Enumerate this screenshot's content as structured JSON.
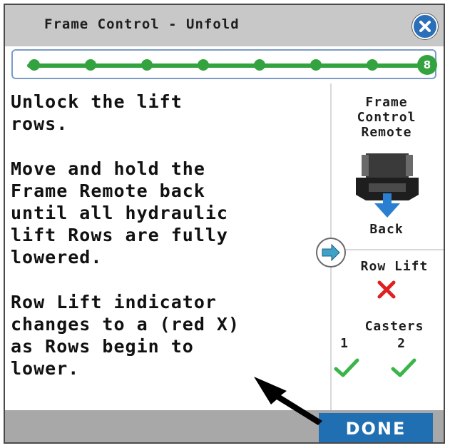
{
  "window": {
    "title": "Frame Control - Unfold"
  },
  "progress": {
    "current_step": "8",
    "total_steps": 8
  },
  "instructions": {
    "para1": "Unlock the lift\nrows.",
    "para2": "Move and hold the\nFrame Remote back\nuntil all hydraulic\nlift Rows are fully\nlowered.",
    "para3": "Row Lift indicator\nchanges to a (red X)\nas Rows begin to\nlower."
  },
  "remote": {
    "label": "Frame\nControl\nRemote",
    "direction_label": "Back"
  },
  "status": {
    "row_lift_label": "Row Lift",
    "row_lift_state": "x",
    "casters_label": "Casters",
    "caster1_label": "1",
    "caster2_label": "2",
    "caster1_state": "check",
    "caster2_state": "check"
  },
  "footer": {
    "done_label": "DONE"
  },
  "colors": {
    "accent_blue": "#1f6fb2",
    "progress_green": "#33a33f",
    "error_red": "#e02020",
    "ok_green": "#3ab54a"
  },
  "icons": [
    "close-icon",
    "remote-joystick-icon",
    "arrow-down-icon",
    "right-arrow-icon",
    "red-x-icon",
    "green-check-icon",
    "pointer-arrow-icon"
  ]
}
